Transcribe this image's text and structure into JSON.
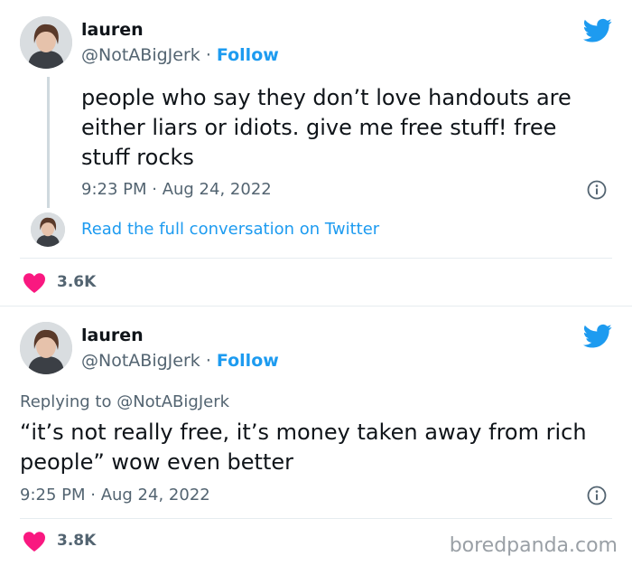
{
  "tweets": [
    {
      "name": "lauren",
      "handle": "@NotABigJerk",
      "dot": " · ",
      "follow": "Follow",
      "text": "people who say they don’t love handouts are either liars or idiots. give me free stuff! free stuff rocks",
      "time": "9:23 PM · Aug 24, 2022",
      "read_link": "Read the full conversation on Twitter",
      "likes": "3.6K"
    },
    {
      "name": "lauren",
      "handle": "@NotABigJerk",
      "dot": " · ",
      "follow": "Follow",
      "replying_prefix": "Replying to ",
      "replying_to": "@NotABigJerk",
      "text": "“it’s not really free, it’s money taken away from rich people” wow even better",
      "time": "9:25 PM · Aug 24, 2022",
      "likes": "3.8K"
    }
  ],
  "watermark": "boredpanda.com",
  "colors": {
    "accent": "#1d9bf0",
    "heart": "#f91880",
    "secondary_text": "#536471"
  },
  "icons": [
    "twitter-bird-icon",
    "info-icon",
    "heart-icon",
    "avatar"
  ]
}
